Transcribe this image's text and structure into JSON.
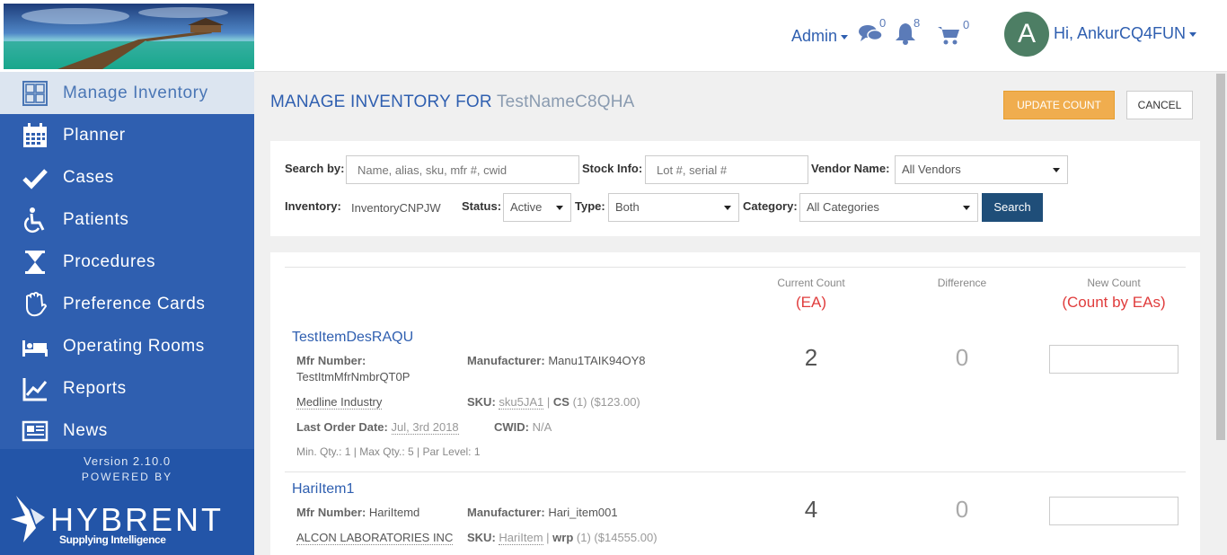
{
  "sidebar": {
    "items": [
      {
        "label": "Manage Inventory",
        "icon": "manage-inventory-icon",
        "active": true
      },
      {
        "label": "Planner",
        "icon": "calendar-icon"
      },
      {
        "label": "Cases",
        "icon": "checkmark-icon"
      },
      {
        "label": "Patients",
        "icon": "wheelchair-icon"
      },
      {
        "label": "Procedures",
        "icon": "hourglass-icon"
      },
      {
        "label": "Preference Cards",
        "icon": "glove-icon"
      },
      {
        "label": "Operating Rooms",
        "icon": "bed-icon"
      },
      {
        "label": "Reports",
        "icon": "chart-icon"
      },
      {
        "label": "News",
        "icon": "newspaper-icon"
      }
    ],
    "version": "Version 2.10.0",
    "powered_by": "POWERED BY",
    "brand": "HYBRENT",
    "tagline": "Supplying Intelligence"
  },
  "topbar": {
    "admin_label": "Admin",
    "messages_count": "0",
    "notifications_count": "8",
    "cart_count": "0",
    "avatar_letter": "A",
    "user_greeting": "Hi, AnkurCQ4FUN"
  },
  "page": {
    "title": "MANAGE INVENTORY FOR",
    "inventory_name": "TestNameC8QHA",
    "update_button": "UPDATE COUNT",
    "cancel_button": "CANCEL"
  },
  "filters": {
    "search_by_label": "Search by:",
    "search_placeholder": "Name, alias, sku, mfr #, cwid",
    "stock_info_label": "Stock Info:",
    "stock_placeholder": "Lot #, serial #",
    "vendor_label": "Vendor Name:",
    "vendor_value": "All Vendors",
    "inventory_label": "Inventory:",
    "inventory_value": "InventoryCNPJW",
    "status_label": "Status:",
    "status_value": "Active",
    "type_label": "Type:",
    "type_value": "Both",
    "category_label": "Category:",
    "category_value": "All Categories",
    "search_button": "Search"
  },
  "columns": {
    "current_count": "Current Count",
    "current_unit": "(EA)",
    "difference": "Difference",
    "new_count": "New Count",
    "new_unit": "(Count by EAs)"
  },
  "items": [
    {
      "name": "TestItemDesRAQU",
      "mfr_number_label": "Mfr Number:",
      "mfr_number": "TestItmMfrNmbrQT0P",
      "manufacturer_label": "Manufacturer:",
      "manufacturer": "Manu1TAIK94OY8",
      "vendor": "Medline Industry",
      "sku_label": "SKU:",
      "sku": "sku5JA1",
      "uom_label": "CS",
      "uom_detail": "(1) ($123.00)",
      "last_order_label": "Last Order Date:",
      "last_order": "Jul, 3rd 2018",
      "cwid_label": "CWID:",
      "cwid": "N/A",
      "levels": "Min. Qty.: 1 | Max Qty.: 5 | Par Level: 1",
      "current_count": "2",
      "difference": "0"
    },
    {
      "name": "HariItem1",
      "mfr_number_label": "Mfr Number:",
      "mfr_number": "HariItemd",
      "manufacturer_label": "Manufacturer:",
      "manufacturer": "Hari_item001",
      "vendor": "ALCON LABORATORIES INC",
      "sku_label": "SKU:",
      "sku": "HariItem",
      "uom_label": "wrp",
      "uom_detail": "(1) ($14555.00)",
      "current_count": "4",
      "difference": "0"
    }
  ]
}
